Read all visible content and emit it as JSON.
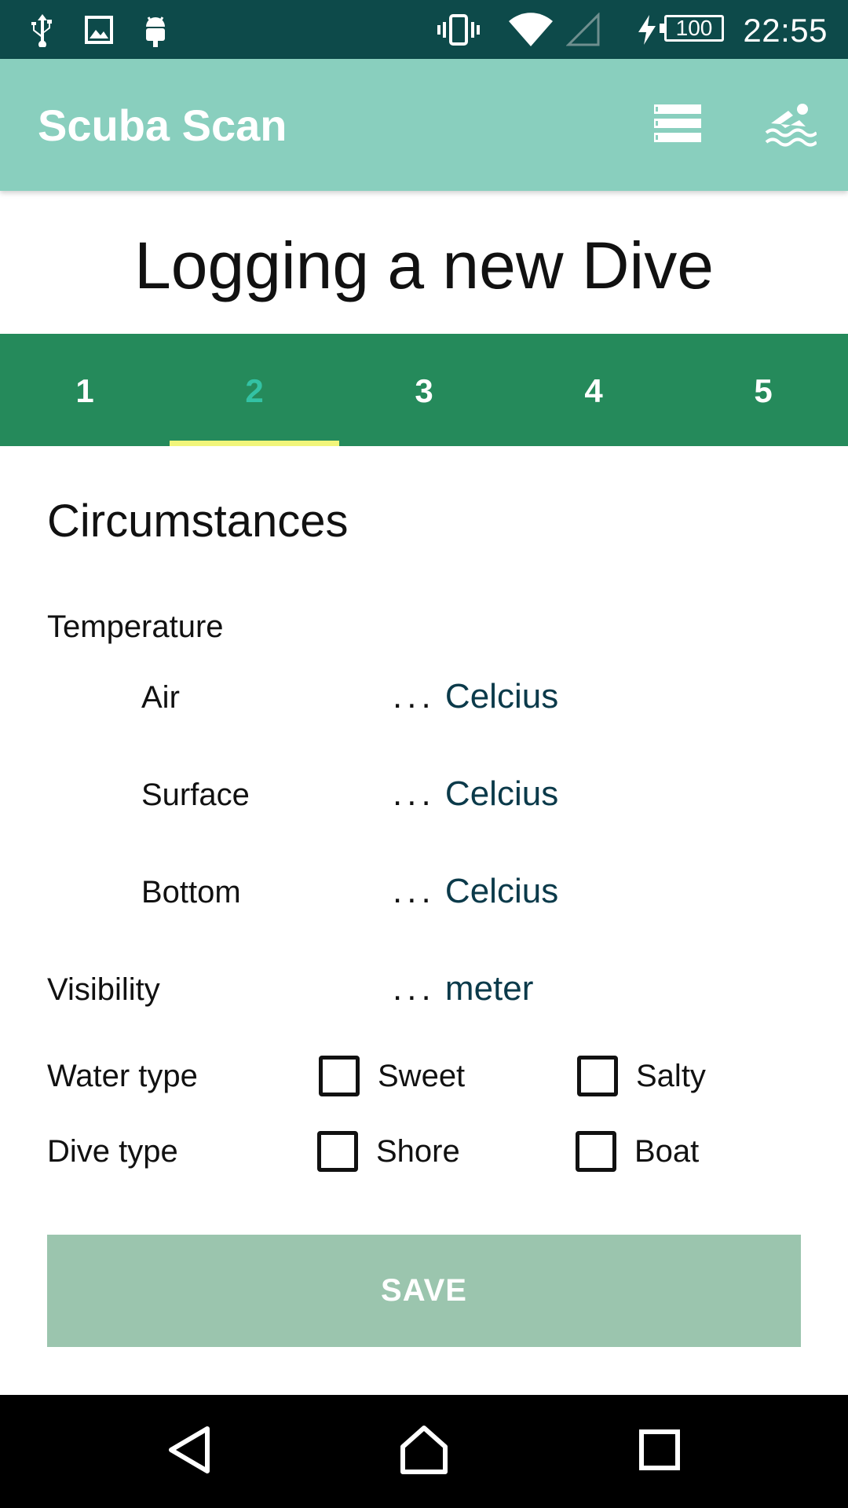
{
  "status_bar": {
    "time": "22:55",
    "battery_level": "100",
    "icons": [
      "usb-icon",
      "image-icon",
      "android-icon",
      "vibrate-icon",
      "wifi-icon",
      "signal-icon",
      "charging-icon",
      "battery-icon"
    ]
  },
  "app_bar": {
    "title": "Scuba Scan",
    "actions": [
      "list-icon",
      "swimmer-icon"
    ]
  },
  "page_title": "Logging a new Dive",
  "tabs": [
    {
      "label": "1",
      "active": false
    },
    {
      "label": "2",
      "active": true
    },
    {
      "label": "3",
      "active": false
    },
    {
      "label": "4",
      "active": false
    },
    {
      "label": "5",
      "active": false
    }
  ],
  "form": {
    "section_title": "Circumstances",
    "temperature_label": "Temperature",
    "air": {
      "label": "Air",
      "placeholder": "...",
      "unit": "Celcius"
    },
    "surface": {
      "label": "Surface",
      "placeholder": "...",
      "unit": "Celcius"
    },
    "bottom": {
      "label": "Bottom",
      "placeholder": "...",
      "unit": "Celcius"
    },
    "visibility": {
      "label": "Visibility",
      "placeholder": "...",
      "unit": "meter"
    },
    "water_type": {
      "label": "Water type",
      "option1": "Sweet",
      "option2": "Salty",
      "option1_checked": false,
      "option2_checked": false
    },
    "dive_type": {
      "label": "Dive type",
      "option1": "Shore",
      "option2": "Boat",
      "option1_checked": false,
      "option2_checked": false
    },
    "save_label": "SAVE"
  },
  "nav_bar": {
    "buttons": [
      "back-icon",
      "home-icon",
      "recents-icon"
    ]
  },
  "colors": {
    "status_bar": "#0d4a4a",
    "app_bar": "#89cfbe",
    "tabs": "#258a5b",
    "active_tab_text": "#33c2a4",
    "tab_indicator": "#f1f57a",
    "save_button": "#9bc5ae"
  }
}
